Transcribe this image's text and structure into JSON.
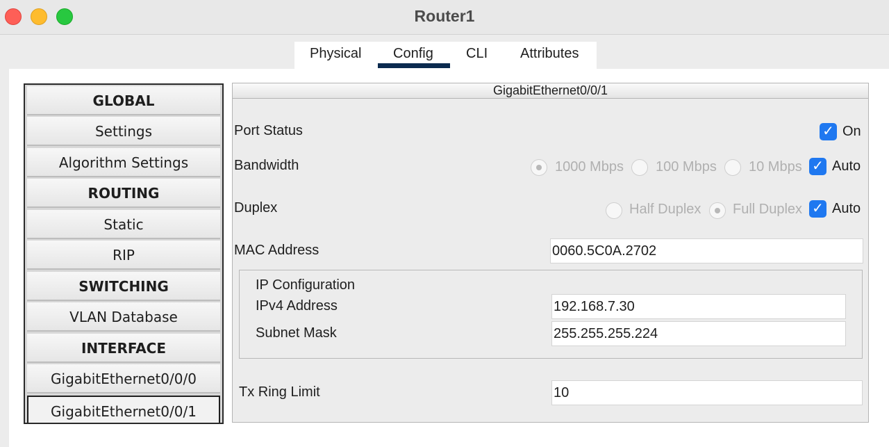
{
  "window": {
    "title": "Router1"
  },
  "tabs": [
    "Physical",
    "Config",
    "CLI",
    "Attributes"
  ],
  "active_tab": "Config",
  "sidebar": {
    "items": [
      {
        "label": "GLOBAL",
        "type": "header"
      },
      {
        "label": "Settings",
        "type": "item"
      },
      {
        "label": "Algorithm Settings",
        "type": "item"
      },
      {
        "label": "ROUTING",
        "type": "header"
      },
      {
        "label": "Static",
        "type": "item"
      },
      {
        "label": "RIP",
        "type": "item"
      },
      {
        "label": "SWITCHING",
        "type": "header"
      },
      {
        "label": "VLAN Database",
        "type": "item"
      },
      {
        "label": "INTERFACE",
        "type": "header"
      },
      {
        "label": "GigabitEthernet0/0/0",
        "type": "item"
      },
      {
        "label": "GigabitEthernet0/0/1",
        "type": "item",
        "selected": true
      }
    ]
  },
  "panel": {
    "title": "GigabitEthernet0/0/1",
    "port_status": {
      "label": "Port Status",
      "toggle_label": "On",
      "checked": true
    },
    "bandwidth": {
      "label": "Bandwidth",
      "options": [
        "1000 Mbps",
        "100 Mbps",
        "10 Mbps"
      ],
      "selected": "1000 Mbps",
      "auto_label": "Auto",
      "auto_checked": true
    },
    "duplex": {
      "label": "Duplex",
      "options": [
        "Half Duplex",
        "Full Duplex"
      ],
      "selected": "Full Duplex",
      "auto_label": "Auto",
      "auto_checked": true
    },
    "mac": {
      "label": "MAC Address",
      "value": "0060.5C0A.2702"
    },
    "ip_config": {
      "title": "IP Configuration",
      "ipv4_label": "IPv4 Address",
      "ipv4_value": "192.168.7.30",
      "mask_label": "Subnet Mask",
      "mask_value": "255.255.255.224"
    },
    "tx_ring": {
      "label": "Tx Ring Limit",
      "value": "10"
    }
  },
  "colors": {
    "checkbox": "#1f78f0",
    "active_tab_bar": "#0b2a4f"
  }
}
